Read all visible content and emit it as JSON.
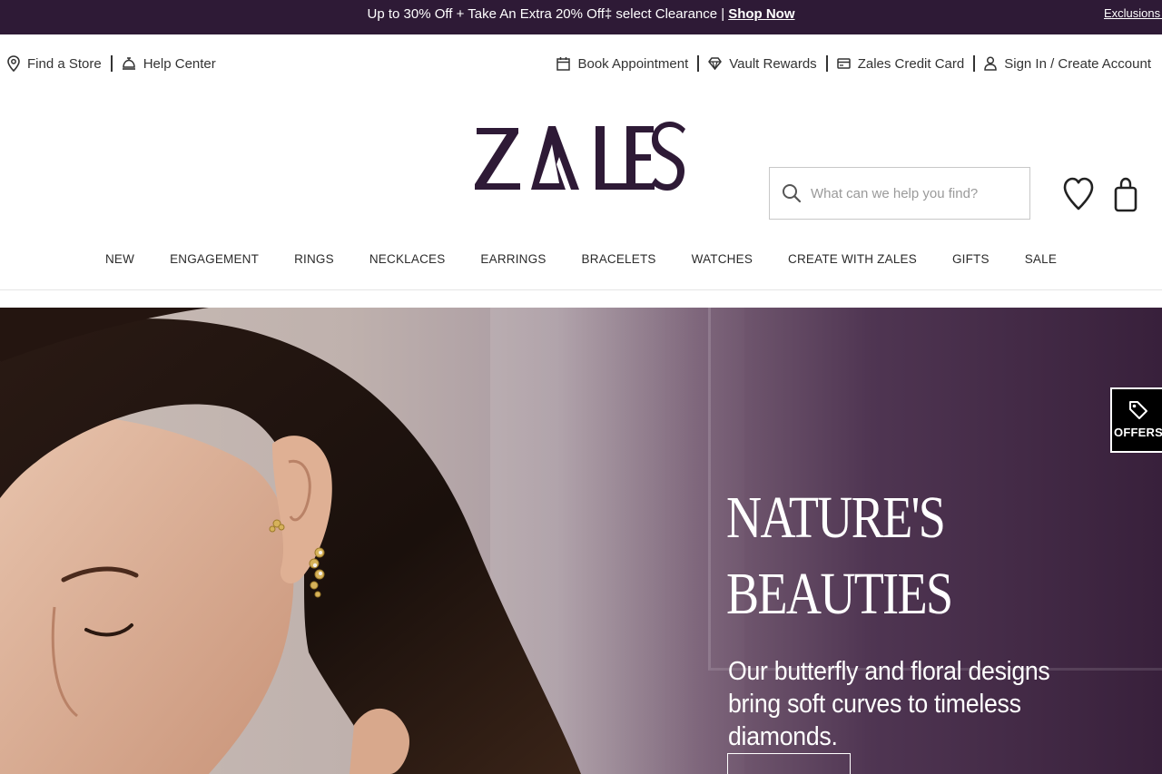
{
  "promo": {
    "text": "Up to 30% Off + Take An Extra 20% Off‡ select Clearance |",
    "link": "Shop Now",
    "exclusions": "Exclusions A"
  },
  "utility": {
    "find_store": "Find a Store",
    "help_center": "Help Center",
    "book_appointment": "Book Appointment",
    "vault_rewards": "Vault Rewards",
    "credit_card": "Zales Credit Card",
    "sign_in": "Sign In / Create Account"
  },
  "brand": {
    "name": "ZALES",
    "color": "#2e1a36"
  },
  "search": {
    "placeholder": "What can we help you find?"
  },
  "nav": {
    "items": [
      "NEW",
      "ENGAGEMENT",
      "RINGS",
      "NECKLACES",
      "EARRINGS",
      "BRACELETS",
      "WATCHES",
      "CREATE WITH ZALES",
      "GIFTS",
      "SALE"
    ]
  },
  "hero": {
    "title_line1": "NATURE'S",
    "title_line2": "BEAUTIES",
    "subtitle": "Our butterfly and floral designs bring soft curves to timeless diamonds."
  },
  "offers": {
    "label": "OFFERS"
  },
  "icons": {
    "location": "map-pin-icon",
    "help": "service-bell-icon",
    "calendar": "calendar-icon",
    "diamond": "diamond-icon",
    "card": "credit-card-icon",
    "user": "user-icon",
    "search": "search-icon",
    "wishlist": "heart-icon",
    "bag": "shopping-bag-icon",
    "tag": "tag-icon"
  }
}
